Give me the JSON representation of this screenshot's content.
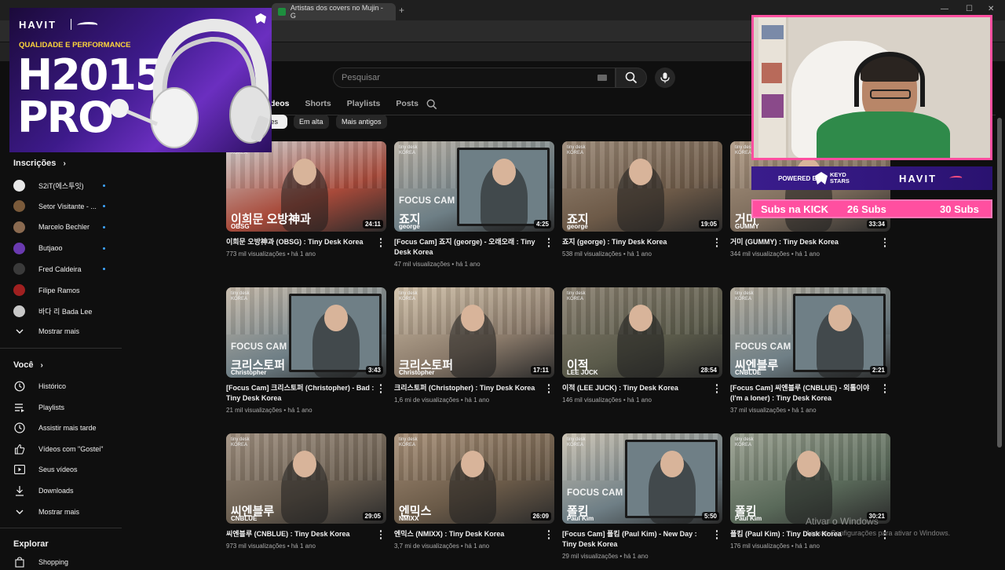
{
  "browser": {
    "tabs": [
      {
        "label": "Artistas dos covers no Mujin - G",
        "favicon_color": "#1e8e3e"
      }
    ],
    "new_tab": "+",
    "window_controls": [
      "—",
      "☐",
      "✕"
    ]
  },
  "header": {
    "search_placeholder": "Pesquisar"
  },
  "channel_tabs": [
    {
      "label": "deos"
    },
    {
      "label": "Shorts"
    },
    {
      "label": "Playlists"
    },
    {
      "label": "Posts"
    }
  ],
  "chips": [
    {
      "label": "tes"
    },
    {
      "label": "Em alta"
    },
    {
      "label": "Mais antigos"
    }
  ],
  "sidebar": {
    "subscriptions_title": "Inscrições",
    "subscriptions": [
      {
        "label": "S2iT(에스투잇)",
        "color": "#e8e8e8"
      },
      {
        "label": "Setor Visitante - ...",
        "color": "#7a5a3a"
      },
      {
        "label": "Marcelo Bechler",
        "color": "#8a6a50"
      },
      {
        "label": "Butjaoo",
        "color": "#6a3ab0"
      },
      {
        "label": "Fred Caldeira",
        "color": "#3a3a3a"
      },
      {
        "label": "Filipe Ramos",
        "color": "#a02020"
      },
      {
        "label": "바다 리 Bada Lee",
        "color": "#c8c8c8"
      }
    ],
    "subscriptions_more": "Mostrar mais",
    "you_title": "Você",
    "you_items": [
      {
        "label": "Histórico",
        "icon": "history-icon"
      },
      {
        "label": "Playlists",
        "icon": "playlists-icon"
      },
      {
        "label": "Assistir mais tarde",
        "icon": "clock-icon"
      },
      {
        "label": "Vídeos com \"Gostei\"",
        "icon": "thumbs-up-icon"
      },
      {
        "label": "Seus vídeos",
        "icon": "play-icon"
      },
      {
        "label": "Downloads",
        "icon": "download-icon"
      }
    ],
    "you_more": "Mostrar mais",
    "explore_title": "Explorar",
    "explore_items": [
      {
        "label": "Shopping",
        "icon": "shopping-icon"
      }
    ]
  },
  "videos": [
    {
      "thumb_label": "이희문 오방神과",
      "thumb_sub": "OBSG",
      "focus": "",
      "duration": "24:11",
      "title": "이희문 오방神과 (OBSG) : Tiny Desk Korea",
      "meta": "773 mil visualizações • há 1 ano",
      "bg": "#a84a3a",
      "bg2": "#cfcfcf"
    },
    {
      "thumb_label": "죠지",
      "thumb_sub": "george",
      "focus": "FOCUS CAM",
      "duration": "4:25",
      "title": "[Focus Cam] 죠지 (george) - 오래오래 : Tiny Desk Korea",
      "meta": "47 mil visualizações • há 1 ano",
      "bg": "#6e7f86",
      "bg2": "#b8b0a4"
    },
    {
      "thumb_label": "죠지",
      "thumb_sub": "george",
      "focus": "",
      "duration": "19:05",
      "title": "죠지 (george) : Tiny Desk Korea",
      "meta": "538 mil visualizações • há 1 ano",
      "bg": "#6d5a48",
      "bg2": "#9a8876"
    },
    {
      "thumb_label": "거미",
      "thumb_sub": "GUMMY",
      "focus": "",
      "duration": "33:34",
      "title": "거미 (GUMMY) : Tiny Desk Korea",
      "meta": "344 mil visualizações • há 1 ano",
      "bg": "#7a6a5a",
      "bg2": "#b09a84"
    },
    {
      "thumb_label": "크리스토퍼",
      "thumb_sub": "Christopher",
      "focus": "FOCUS CAM",
      "duration": "3:43",
      "title": "[Focus Cam] 크리스토퍼 (Christopher) - Bad : Tiny Desk Korea",
      "meta": "21 mil visualizações • há 1 ano",
      "bg": "#6f7f86",
      "bg2": "#c4b8a8"
    },
    {
      "thumb_label": "크리스토퍼",
      "thumb_sub": "Christopher",
      "focus": "",
      "duration": "17:11",
      "title": "크리스토퍼 (Christopher) : Tiny Desk Korea",
      "meta": "1,6 mi de visualizações • há 1 ano",
      "bg": "#8a7a6a",
      "bg2": "#d0c0a8"
    },
    {
      "thumb_label": "이적",
      "thumb_sub": "LEE JUCK",
      "focus": "",
      "duration": "28:54",
      "title": "이적 (LEE JUCK) : Tiny Desk Korea",
      "meta": "146 mil visualizações • há 1 ano",
      "bg": "#5a5a4a",
      "bg2": "#8a8070"
    },
    {
      "thumb_label": "씨엔블루",
      "thumb_sub": "CNBLUE",
      "focus": "FOCUS CAM",
      "duration": "2:21",
      "title": "[Focus Cam] 씨엔블루 (CNBLUE) - 외톨이야 (I'm a loner) : Tiny Desk Korea",
      "meta": "37 mil visualizações • há 1 ano",
      "bg": "#6f7f86",
      "bg2": "#b0a898"
    },
    {
      "thumb_label": "씨엔블루",
      "thumb_sub": "CNBLUE",
      "focus": "",
      "duration": "29:05",
      "title": "씨엔블루 (CNBLUE) : Tiny Desk Korea",
      "meta": "973 mil visualizações • há 1 ano",
      "bg": "#6a5e50",
      "bg2": "#a09080"
    },
    {
      "thumb_label": "엔믹스",
      "thumb_sub": "NMIXX",
      "focus": "",
      "duration": "26:09",
      "title": "엔믹스 (NMIXX) : Tiny Desk Korea",
      "meta": "3,7 mi de visualizações • há 1 ano",
      "bg": "#6a5a48",
      "bg2": "#a89078"
    },
    {
      "thumb_label": "폴킴",
      "thumb_sub": "Paul Kim",
      "focus": "FOCUS CAM",
      "duration": "5:50",
      "title": "[Focus Cam] 폴킴 (Paul Kim) - New Day : Tiny Desk Korea",
      "meta": "29 mil visualizações • há 1 ano",
      "bg": "#6f7f86",
      "bg2": "#c8c0b0"
    },
    {
      "thumb_label": "폴킴",
      "thumb_sub": "Paul Kim",
      "focus": "",
      "duration": "30:21",
      "title": "폴킴 (Paul Kim) : Tiny Desk Korea",
      "meta": "176 mil visualizações • há 1 ano",
      "bg": "#5a6a5a",
      "bg2": "#9aa090"
    }
  ],
  "tiny_desk": "tiny desk\nKOREA",
  "ad": {
    "brand": "HAVIT",
    "tagline": "QUALIDADE E PERFORMANCE",
    "model_line1": "H2015",
    "model_line2": "PRO"
  },
  "overlay": {
    "powered_by": "POWERED BY",
    "partner": "KEYD\nSTARS",
    "sponsor": "HAVIT",
    "subs_label": "Subs na KICK",
    "subs_current": "26 Subs",
    "subs_goal": "30 Subs"
  },
  "watermark": {
    "line1": "Ativar o Windows",
    "line2": "Acesse Configurações para ativar o Windows."
  }
}
